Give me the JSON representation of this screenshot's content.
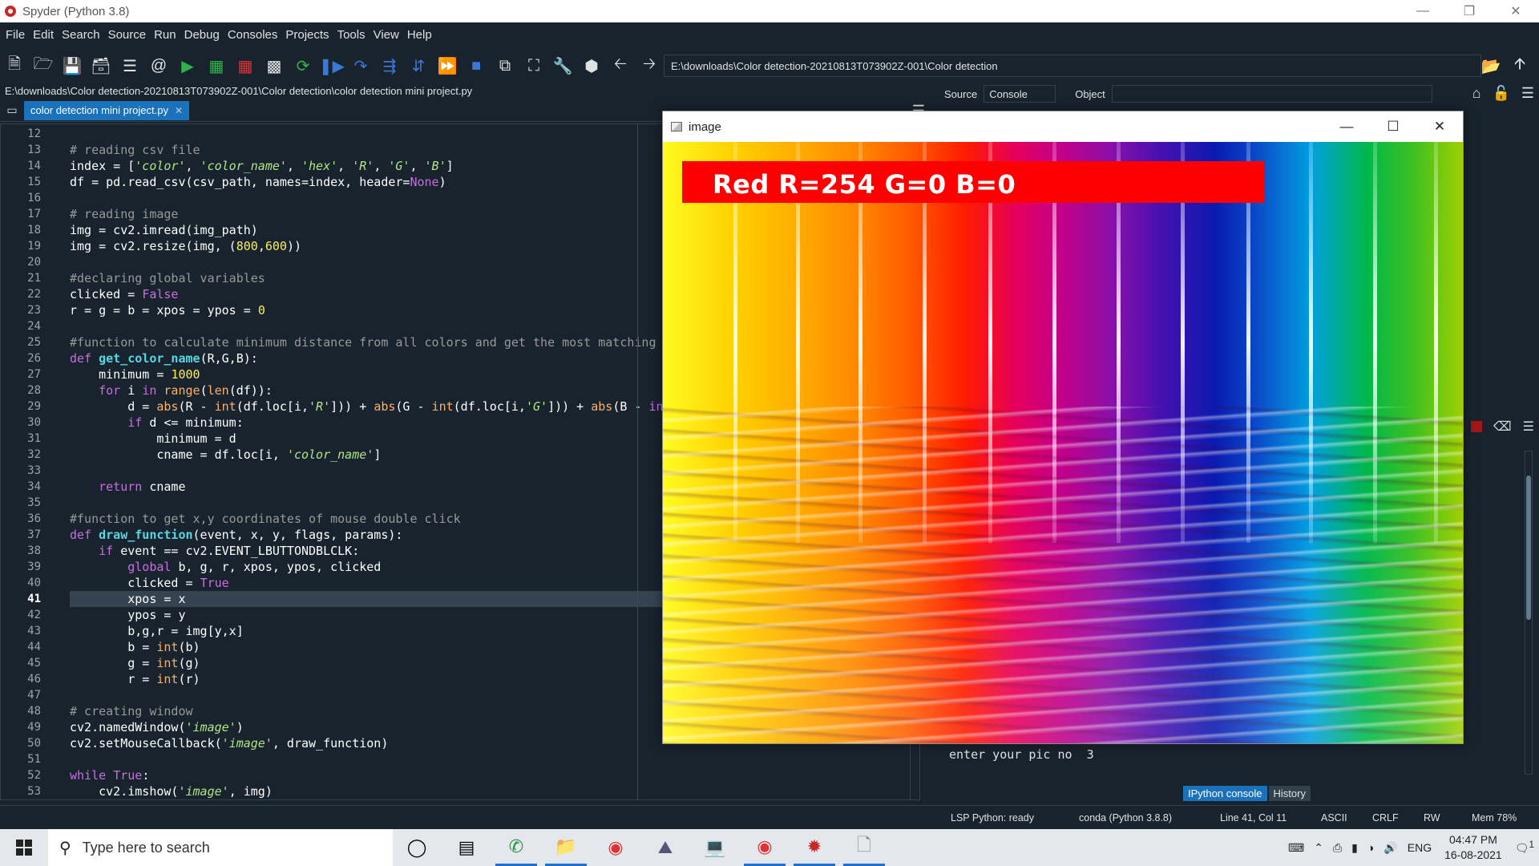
{
  "window": {
    "title": "Spyder (Python 3.8)"
  },
  "menu": [
    "File",
    "Edit",
    "Search",
    "Source",
    "Run",
    "Debug",
    "Consoles",
    "Projects",
    "Tools",
    "View",
    "Help"
  ],
  "toolbar": {
    "working_dir": "E:\\downloads\\Color detection-20210813T073902Z-001\\Color detection"
  },
  "editor": {
    "file_path": "E:\\downloads\\Color detection-20210813T073902Z-001\\Color detection\\color detection mini project.py",
    "tab_label": "color detection mini project.py",
    "current_line": 41,
    "lines": [
      {
        "n": 12,
        "code": ""
      },
      {
        "n": 13,
        "code": "# reading csv file"
      },
      {
        "n": 14,
        "code": "index = ['color', 'color_name', 'hex', 'R', 'G', 'B']"
      },
      {
        "n": 15,
        "code": "df = pd.read_csv(csv_path, names=index, header=None)"
      },
      {
        "n": 16,
        "code": ""
      },
      {
        "n": 17,
        "code": "# reading image"
      },
      {
        "n": 18,
        "code": "img = cv2.imread(img_path)"
      },
      {
        "n": 19,
        "code": "img = cv2.resize(img, (800,600))"
      },
      {
        "n": 20,
        "code": ""
      },
      {
        "n": 21,
        "code": "#declaring global variables"
      },
      {
        "n": 22,
        "code": "clicked = False"
      },
      {
        "n": 23,
        "code": "r = g = b = xpos = ypos = 0"
      },
      {
        "n": 24,
        "code": ""
      },
      {
        "n": 25,
        "code": "#function to calculate minimum distance from all colors and get the most matching"
      },
      {
        "n": 26,
        "code": "def get_color_name(R,G,B):"
      },
      {
        "n": 27,
        "code": "    minimum = 1000"
      },
      {
        "n": 28,
        "code": "    for i in range(len(df)):"
      },
      {
        "n": 29,
        "code": "        d = abs(R - int(df.loc[i,'R'])) + abs(G - int(df.loc[i,'G'])) + abs(B - in"
      },
      {
        "n": 30,
        "code": "        if d <= minimum:"
      },
      {
        "n": 31,
        "code": "            minimum = d"
      },
      {
        "n": 32,
        "code": "            cname = df.loc[i, 'color_name']"
      },
      {
        "n": 33,
        "code": ""
      },
      {
        "n": 34,
        "code": "    return cname"
      },
      {
        "n": 35,
        "code": ""
      },
      {
        "n": 36,
        "code": "#function to get x,y coordinates of mouse double click"
      },
      {
        "n": 37,
        "code": "def draw_function(event, x, y, flags, params):"
      },
      {
        "n": 38,
        "code": "    if event == cv2.EVENT_LBUTTONDBLCLK:"
      },
      {
        "n": 39,
        "code": "        global b, g, r, xpos, ypos, clicked"
      },
      {
        "n": 40,
        "code": "        clicked = True"
      },
      {
        "n": 41,
        "code": "        xpos = x"
      },
      {
        "n": 42,
        "code": "        ypos = y"
      },
      {
        "n": 43,
        "code": "        b,g,r = img[y,x]"
      },
      {
        "n": 44,
        "code": "        b = int(b)"
      },
      {
        "n": 45,
        "code": "        g = int(g)"
      },
      {
        "n": 46,
        "code": "        r = int(r)"
      },
      {
        "n": 47,
        "code": ""
      },
      {
        "n": 48,
        "code": "# creating window"
      },
      {
        "n": 49,
        "code": "cv2.namedWindow('image')"
      },
      {
        "n": 50,
        "code": "cv2.setMouseCallback('image', draw_function)"
      },
      {
        "n": 51,
        "code": ""
      },
      {
        "n": 52,
        "code": "while True:"
      },
      {
        "n": 53,
        "code": "    cv2.imshow('image', img)"
      }
    ]
  },
  "help_pane": {
    "source_label": "Source",
    "source_value": "Console",
    "object_label": "Object",
    "object_value": ""
  },
  "console": {
    "last_line": "enter your pic no  3",
    "tabs": [
      "IPython console",
      "History"
    ],
    "active_tab": "IPython console"
  },
  "statusbar": {
    "lsp": "LSP Python: ready",
    "env": "conda (Python 3.8.8)",
    "position": "Line 41, Col 11",
    "encoding": "ASCII",
    "eol": "CRLF",
    "permissions": "RW",
    "memory": "Mem 78%"
  },
  "image_window": {
    "title": "image",
    "banner_text": "Red R=254 G=0 B=0",
    "banner_color": "#fe0000"
  },
  "taskbar": {
    "search_placeholder": "Type here to search",
    "language": "ENG",
    "time": "04:47 PM",
    "date": "16-08-2021",
    "notification_count": "1"
  }
}
